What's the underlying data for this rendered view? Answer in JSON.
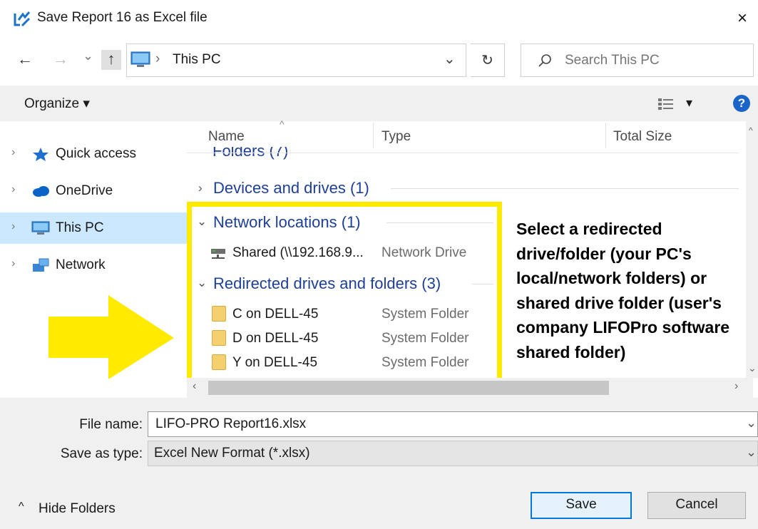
{
  "window": {
    "title": "Save Report 16 as Excel file",
    "close": "×"
  },
  "nav": {
    "back": "←",
    "forward": "→",
    "recent": "⌄",
    "up": "↑"
  },
  "address": {
    "separator": "›",
    "location": "This PC",
    "dropdown": "⌄",
    "refresh": "↻"
  },
  "search": {
    "placeholder": "Search This PC"
  },
  "toolbar": {
    "organize": "Organize ▾",
    "view": "▾",
    "help": "?"
  },
  "sidebar": {
    "items": [
      {
        "label": "Quick access",
        "icon": "star-icon"
      },
      {
        "label": "OneDrive",
        "icon": "cloud-icon"
      },
      {
        "label": "This PC",
        "icon": "computer-icon",
        "selected": true
      },
      {
        "label": "Network",
        "icon": "network-icon"
      }
    ]
  },
  "columns": {
    "name": "Name",
    "type": "Type",
    "size": "Total Size"
  },
  "groups": [
    {
      "title": "Folders (7)",
      "expanded": false
    },
    {
      "title": "Devices and drives (1)",
      "expanded": false
    },
    {
      "title": "Network locations (1)",
      "expanded": true
    },
    {
      "title": "Redirected drives and folders (3)",
      "expanded": true
    }
  ],
  "network_items": [
    {
      "name": "Shared (\\\\192.168.9...",
      "type": "Network Drive"
    }
  ],
  "redirected_items": [
    {
      "name": "C on DELL-45",
      "type": "System Folder"
    },
    {
      "name": "D on DELL-45",
      "type": "System Folder"
    },
    {
      "name": "Y on DELL-45",
      "type": "System Folder"
    }
  ],
  "annotation": {
    "lines": [
      "Select a redirected",
      "drive/folder (your PC's",
      "local/network folders) or",
      "shared drive folder (user's",
      "company LIFOPro software",
      "shared folder)"
    ],
    "highlight_color": "#ffea00"
  },
  "form": {
    "filename_label": "File name:",
    "filename_value": "LIFO-PRO Report16.xlsx",
    "type_label": "Save as type:",
    "type_value": "Excel New Format (*.xlsx)"
  },
  "footer": {
    "hide_folders": "Hide Folders",
    "save": "Save",
    "cancel": "Cancel"
  },
  "colors": {
    "accent": "#0078d7",
    "group_title": "#1e3f97",
    "selected": "#cce8ff"
  }
}
